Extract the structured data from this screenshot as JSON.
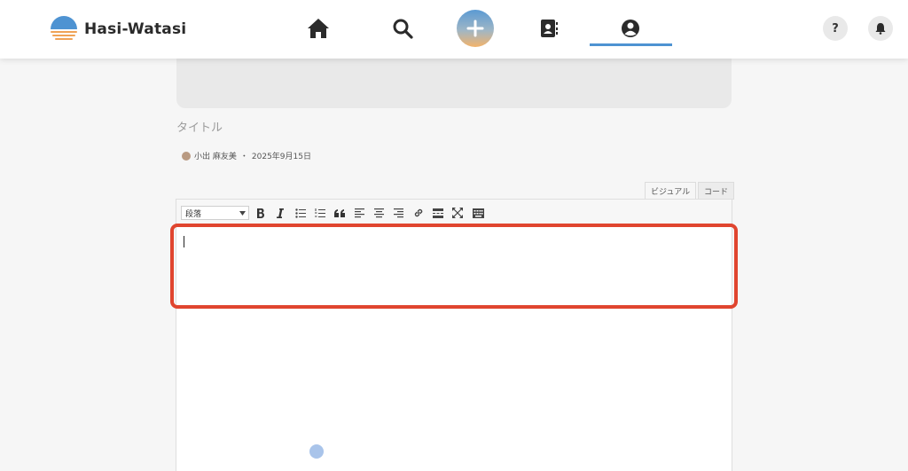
{
  "header": {
    "logo_text": "Hasi-Watasi",
    "accent_color": "#4e93d2",
    "nav": [
      {
        "name": "home",
        "icon": "home-icon"
      },
      {
        "name": "search",
        "icon": "search-icon"
      },
      {
        "name": "create",
        "icon": "plus-icon"
      },
      {
        "name": "contacts",
        "icon": "contact-book-icon"
      },
      {
        "name": "profile",
        "icon": "user-circle-icon",
        "active": true
      }
    ],
    "help_label": "?",
    "notification_icon": "bell-icon"
  },
  "post": {
    "title_placeholder": "タイトル",
    "author": "小出 麻友美",
    "separator": "・",
    "date": "2025年9月15日"
  },
  "editor": {
    "tabs": [
      {
        "label": "ビジュアル",
        "active": true
      },
      {
        "label": "コード",
        "active": false
      }
    ],
    "format_select": "段落",
    "toolbar_buttons": [
      "bold",
      "italic",
      "bullet-list",
      "numbered-list",
      "blockquote",
      "align-left",
      "align-center",
      "align-right",
      "link",
      "read-more",
      "fullscreen",
      "toolbar-toggle"
    ],
    "highlight_color": "#e0452f"
  }
}
